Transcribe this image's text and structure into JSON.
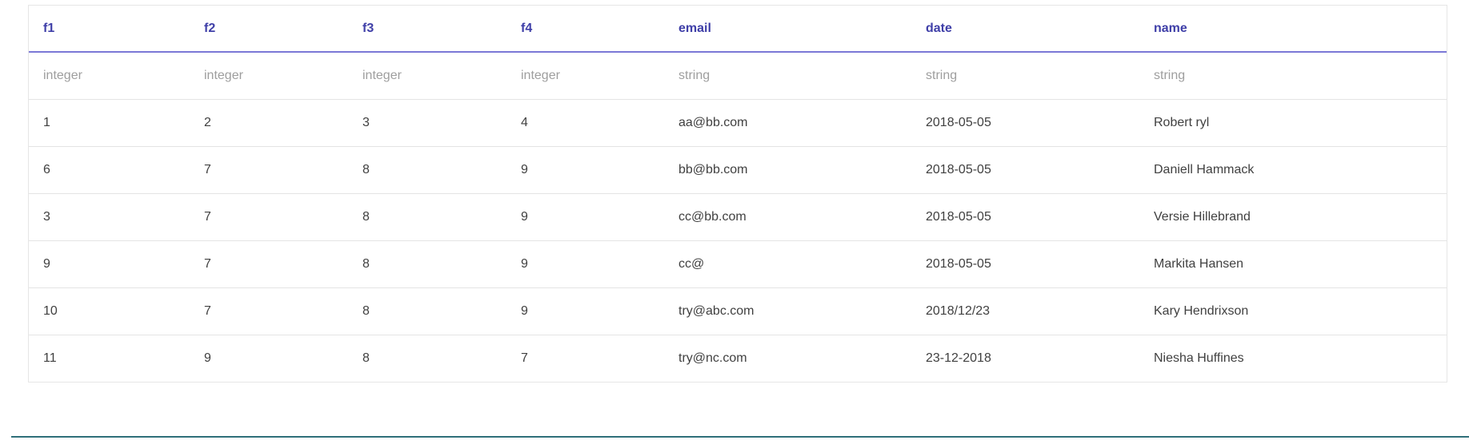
{
  "table": {
    "columns": [
      "f1",
      "f2",
      "f3",
      "f4",
      "email",
      "date",
      "name"
    ],
    "types": [
      "integer",
      "integer",
      "integer",
      "integer",
      "string",
      "string",
      "string"
    ],
    "rows": [
      [
        "1",
        "2",
        "3",
        "4",
        "aa@bb.com",
        "2018-05-05",
        "Robert ryl"
      ],
      [
        "6",
        "7",
        "8",
        "9",
        "bb@bb.com",
        "2018-05-05",
        "Daniell Hammack"
      ],
      [
        "3",
        "7",
        "8",
        "9",
        "cc@bb.com",
        "2018-05-05",
        "Versie Hillebrand"
      ],
      [
        "9",
        "7",
        "8",
        "9",
        "cc@",
        "2018-05-05",
        "Markita Hansen"
      ],
      [
        "10",
        "7",
        "8",
        "9",
        "try@abc.com",
        "2018/12/23",
        "Kary Hendrixson"
      ],
      [
        "11",
        "9",
        "8",
        "7",
        "try@nc.com",
        "23-12-2018",
        "Niesha Huffines"
      ]
    ]
  },
  "colors": {
    "header_text": "#3f3fa8",
    "header_rule": "#7b78d6",
    "type_text": "#9e9e9e",
    "cell_text": "#404040",
    "bottom_rule": "#2f6f7a"
  }
}
